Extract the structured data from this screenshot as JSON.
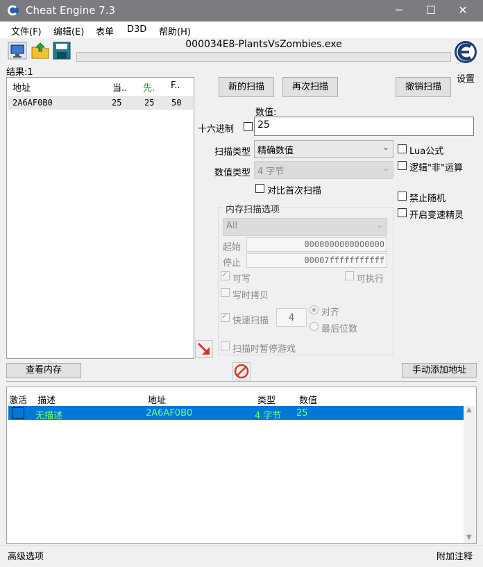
{
  "window": {
    "title": "Cheat Engine 7.3",
    "controls": {
      "minimize": "─",
      "maximize": "☐",
      "close": "✕"
    }
  },
  "menu": [
    "文件(F)",
    "编辑(E)",
    "表单",
    "D3D",
    "帮助(H)"
  ],
  "toolbar": {
    "icons": [
      "open-process-icon",
      "open-file-icon",
      "save-icon"
    ],
    "process_name": "000034E8-PlantsVsZombies.exe",
    "settings_label": "设置"
  },
  "results": {
    "found_label": "结果:1",
    "columns": [
      "地址",
      "当..",
      "先.",
      "F.."
    ],
    "rows": [
      {
        "address": "2A6AF0B0",
        "current": "25",
        "previous": "25",
        "first": "50"
      }
    ]
  },
  "scan": {
    "new_scan": "新的扫描",
    "next_scan": "再次扫描",
    "undo_scan": "撤销扫描",
    "value_label": "数值:",
    "hex_label": "十六进制",
    "value": "25",
    "scan_type_label": "扫描类型",
    "scan_type_value": "精确数值",
    "value_type_label": "数值类型",
    "value_type_value": "4 字节",
    "compare_first": "对比首次扫描",
    "lua_formula": "Lua公式",
    "logical_not": "逻辑\"非\"运算",
    "no_random": "禁止随机",
    "speedhack": "开启变速精灵"
  },
  "memory_options": {
    "title": "内存扫描选项",
    "region": "All",
    "start_label": "起始",
    "start_value": "0000000000000000",
    "stop_label": "停止",
    "stop_value": "00007fffffffffff",
    "writable": "可写",
    "executable": "可执行",
    "copy_on_write": "写时拷贝",
    "fast_scan": "快速扫描",
    "fast_scan_value": "4",
    "align": "对齐",
    "last_digits": "最后位数",
    "pause_game": "扫描时暂停游戏"
  },
  "actions": {
    "view_memory": "查看内存",
    "add_address": "手动添加地址"
  },
  "address_list": {
    "columns": [
      "激活",
      "描述",
      "地址",
      "类型",
      "数值"
    ],
    "rows": [
      {
        "description": "无描述",
        "address": "2A6AF0B0",
        "type": "4 字节",
        "value": "25"
      }
    ]
  },
  "status": {
    "advanced": "高级选项",
    "comments": "附加注释"
  },
  "colors": {
    "titlebar": "#7b7b80",
    "selection": "#0078d7",
    "selection_text": "#7cff6a",
    "accent_red": "#d9342b"
  }
}
